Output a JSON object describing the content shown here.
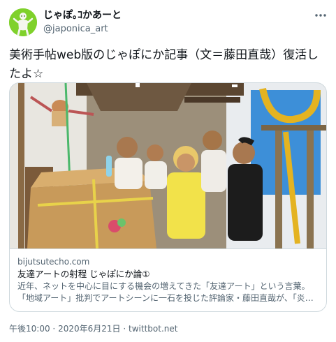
{
  "user": {
    "display_name": "じゃぽ｡ｺかあーと",
    "handle": "@japonica_art",
    "avatar_icon": "person-avatar-icon",
    "avatar_color": "#7fd12b"
  },
  "menu": {
    "icon": "more-horizontal-icon"
  },
  "tweet": {
    "text": "美術手帖web版のじゃぽにか記事（文＝藤田直哉）復活したよ☆"
  },
  "card": {
    "image_icon": "article-photo-icon",
    "domain": "bijutsutecho.com",
    "title": "友達アートの射程 じゃぽにか論①",
    "description_line1": "近年、ネットを中心に目にする機会の増えてきた「友達アート」という言葉。",
    "description_line2": "「地域アート」批判でアートシーンに一石を投じた評論家・藤田直哉が、「炎…"
  },
  "meta": {
    "time": "午後10:00",
    "separator1": "·",
    "date": "2020年6月21日",
    "separator2": "·",
    "source": "twittbot.net"
  },
  "colors": {
    "text_primary": "#0f1419",
    "text_secondary": "#536471",
    "border": "#cfd9de"
  }
}
